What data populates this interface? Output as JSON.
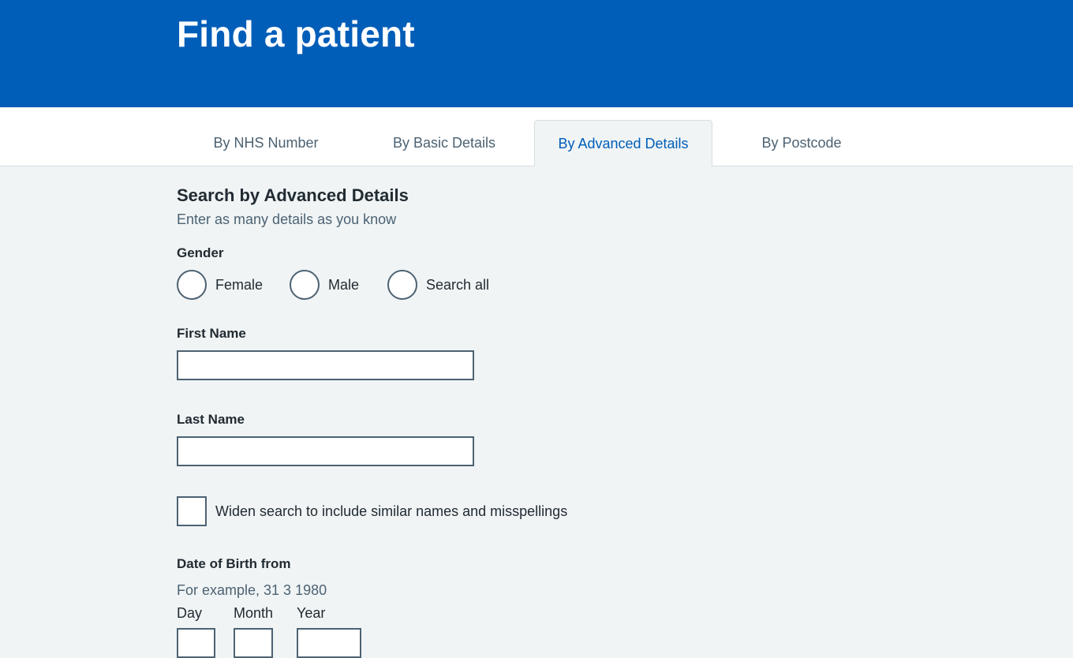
{
  "header": {
    "title": "Find a patient"
  },
  "tabs": [
    {
      "label": "By NHS Number",
      "active": false
    },
    {
      "label": "By Basic Details",
      "active": false
    },
    {
      "label": "By Advanced Details",
      "active": true
    },
    {
      "label": "By Postcode",
      "active": false
    }
  ],
  "form": {
    "heading": "Search by Advanced Details",
    "hint": "Enter as many details as you know",
    "gender": {
      "label": "Gender",
      "options": [
        "Female",
        "Male",
        "Search all"
      ],
      "selected": null
    },
    "first_name": {
      "label": "First Name",
      "value": ""
    },
    "last_name": {
      "label": "Last Name",
      "value": ""
    },
    "widen_search": {
      "label": "Widen search to include similar names and misspellings",
      "checked": false
    },
    "dob_from": {
      "label": "Date of Birth from",
      "hint": "For example, 31 3 1980",
      "day_label": "Day",
      "month_label": "Month",
      "year_label": "Year",
      "day": "",
      "month": "",
      "year": ""
    }
  },
  "colors": {
    "brand_blue": "#005eb8",
    "background": "#f0f4f5",
    "text": "#212b32",
    "secondary_text": "#4c6272",
    "border": "#4c6272"
  }
}
